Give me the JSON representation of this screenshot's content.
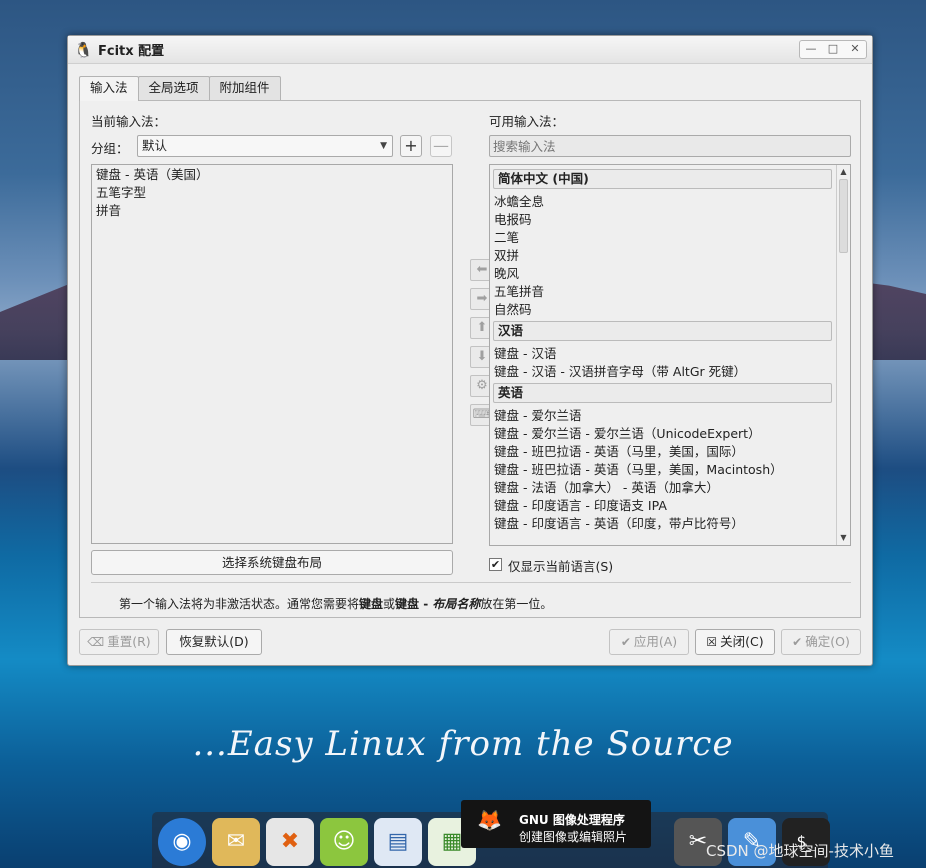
{
  "window": {
    "title": "Fcitx 配置",
    "controls": [
      "—",
      "□",
      "✕"
    ]
  },
  "tabs": [
    {
      "label": "输入法",
      "active": true
    },
    {
      "label": "全局选项",
      "active": false
    },
    {
      "label": "附加组件",
      "active": false
    }
  ],
  "left": {
    "title": "当前输入法：",
    "group_label": "分组：",
    "group_value": "默认",
    "add_label": "+",
    "remove_label": "—",
    "items": [
      "键盘 - 英语（美国）",
      "五笔字型",
      "拼音"
    ],
    "layout_button": "选择系统键盘布局"
  },
  "middle": {
    "buttons": [
      {
        "icon": "arrow-left-icon",
        "glyph": "⬅"
      },
      {
        "icon": "arrow-right-icon",
        "glyph": "➡"
      },
      {
        "icon": "arrow-up-icon",
        "glyph": "⬆"
      },
      {
        "icon": "arrow-down-icon",
        "glyph": "⬇"
      },
      {
        "icon": "gear-icon",
        "glyph": "⚙"
      },
      {
        "icon": "keyboard-icon",
        "glyph": "⌨"
      }
    ]
  },
  "right": {
    "title": "可用输入法：",
    "search_placeholder": "搜索输入法",
    "groups": [
      {
        "header": "简体中文 (中国)",
        "items": [
          "冰蟾全息",
          "电报码",
          "二笔",
          "双拼",
          "晚风",
          "五笔拼音",
          "自然码"
        ]
      },
      {
        "header": "汉语",
        "items": [
          "键盘 - 汉语",
          "键盘 - 汉语 - 汉语拼音字母（带 AltGr 死键）"
        ]
      },
      {
        "header": "英语",
        "items": [
          "键盘 - 爱尔兰语",
          "键盘 - 爱尔兰语 - 爱尔兰语（UnicodeExpert）",
          "键盘 - 班巴拉语 - 英语（马里，美国，国际）",
          "键盘 - 班巴拉语 - 英语（马里，美国，Macintosh）",
          "键盘 - 法语（加拿大） - 英语（加拿大）",
          "键盘 - 印度语言 - 印度语支 IPA",
          "键盘 - 印度语言 - 英语（印度，带卢比符号）"
        ]
      }
    ],
    "only_current_language": "仅显示当前语言(S)",
    "only_current_checked": true
  },
  "info": {
    "prefix": "第一个输入法将为非激活状态。通常您需要将",
    "bold1": "键盘",
    "middle": "或",
    "bold2": "键盘 - ",
    "bold2_italic": "布局名称",
    "suffix": "放在第一位。"
  },
  "footer": {
    "reset": "重置(R)",
    "restore_default": "恢复默认(D)",
    "apply": "应用(A)",
    "close": "关闭(C)",
    "ok": "确定(O)"
  },
  "desktop": {
    "slogan": "...Easy Linux from the Source",
    "tooltip_title": "GNU 图像处理程序",
    "tooltip_desc": "创建图像或编辑照片",
    "watermark": "CSDN @地球空间-技术小鱼"
  }
}
